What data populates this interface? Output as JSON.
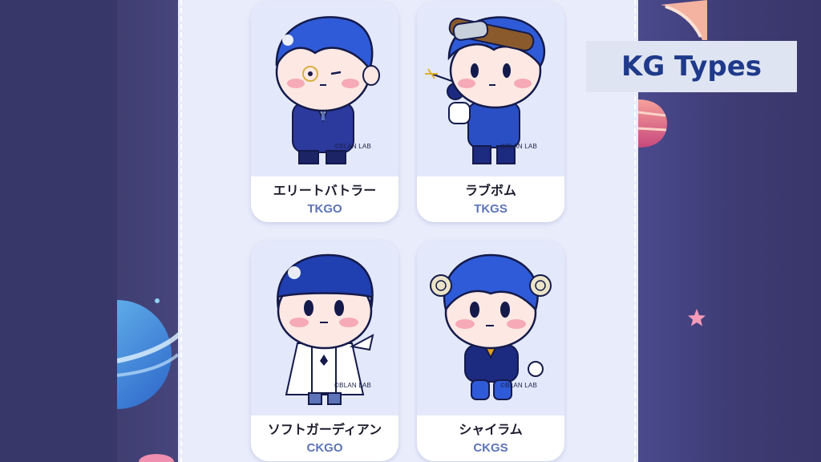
{
  "badge": {
    "title": "KG Types"
  },
  "cards": [
    {
      "name": "エリートバトラー",
      "code": "TKGO",
      "copyright": "©BLAN LAB"
    },
    {
      "name": "ラブボム",
      "code": "TKGS",
      "copyright": "©BLAN LAB"
    },
    {
      "name": "ソフトガーディアン",
      "code": "CKGO",
      "copyright": "©BLAN LAB"
    },
    {
      "name": "シャイラム",
      "code": "CKGS",
      "copyright": "©BLAN LAB"
    }
  ],
  "colors": {
    "background": "#3c3a6e",
    "panel": "#e9ecfb",
    "card": "#ffffff",
    "code_text": "#5d74b8",
    "badge_text": "#1f3a8a",
    "hair_blue": "#2f5bd8"
  },
  "icons": {
    "planet": "planet-icon",
    "star": "star-icon",
    "character": "character-illustration"
  }
}
